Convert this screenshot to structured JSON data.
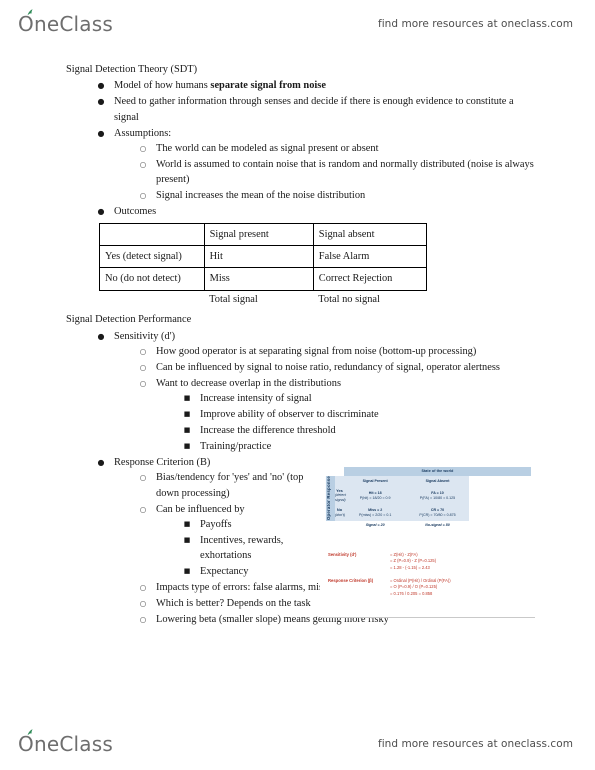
{
  "branding": {
    "logo_text": "OneClass",
    "tagline": "find more resources at oneclass.com",
    "leaf_color": "#2e8b57",
    "logo_color": "#6e6e6e"
  },
  "note": {
    "title_1": "Signal Detection Theory (SDT)",
    "title_2": "Signal Detection Performance",
    "sdt_bullets": {
      "b1_pre": "Model of how humans ",
      "b1_bold": "separate signal from noise",
      "b2": "Need to gather information through senses and decide if there is enough evidence to constitute a signal",
      "b3": "Assumptions:",
      "b3_subs": [
        "The world can be modeled as signal present or absent",
        "World is assumed to contain noise that is random and normally distributed (noise is always present)",
        "Signal increases the mean of the noise distribution"
      ],
      "b4": "Outcomes"
    },
    "outcomes_table": {
      "header": [
        "",
        "Signal present",
        "Signal absent"
      ],
      "rows": [
        [
          "Yes (detect signal)",
          "Hit",
          "False Alarm"
        ],
        [
          "No (do not detect)",
          "Miss",
          "Correct Rejection"
        ]
      ],
      "totals": [
        "",
        "Total signal",
        "Total no signal"
      ]
    },
    "sensitivity": {
      "label": "Sensitivity (d')",
      "subs": [
        "How good operator is at separating signal from noise (bottom-up processing)",
        "Can be influenced by signal to noise ratio, redundancy of signal, operator alertness",
        "Want to decrease overlap in the distributions"
      ],
      "subsubs": [
        "Increase intensity of signal",
        "Improve ability of observer to discriminate",
        "Increase the difference threshold",
        "Training/practice"
      ]
    },
    "response_criterion": {
      "label": "Response Criterion (B)",
      "subs_a": [
        "Bias/tendency for 'yes' and 'no' (top down processing)",
        "Can be influenced by"
      ],
      "subsubs": [
        "Payoffs",
        "Incentives, rewards, exhortations",
        "Expectancy"
      ],
      "subs_b": [
        "Impacts type of errors: false alarms, misses",
        "Which is better? Depends on the task",
        "Lowering beta (smaller slope) means getting more risky"
      ]
    }
  },
  "slide": {
    "matrix": {
      "top_header": "State of the world",
      "col_headers": [
        "Signal Present",
        "Signal Absent"
      ],
      "row_axis_label": "Operator Response",
      "rows": [
        {
          "label_line1": "Yes",
          "label_line2": "(detect signal)",
          "signal_present_l1": "Hit = 18",
          "signal_present_l2": "P(hit) = 18/20 = 0.9",
          "signal_absent_l1": "FA = 10",
          "signal_absent_l2": "P(FA) = 10/80 = 0.125"
        },
        {
          "label_line1": "No",
          "label_line2": "(don't)",
          "signal_present_l1": "Miss = 2",
          "signal_present_l2": "P(miss) = 2/20 = 0.1",
          "signal_absent_l1": "CR = 70",
          "signal_absent_l2": "P(CR) = 70/80 = 0.875"
        }
      ],
      "totals": [
        "Signal = 20",
        "No-signal = 80"
      ]
    },
    "formulas": [
      {
        "label": "Sensitivity (d')",
        "lines": [
          "= Z(Hit) - Z(FA)",
          "= Z (P=0.9) - Z (P=0.125)",
          "= 1.28 - (-1.15) = 2.43"
        ]
      },
      {
        "label": "Response Criterion (β)",
        "lines": [
          "= Ordinal (P(Hit) / Ordinal (P(FA))",
          "= O (P=0.9) / O (P=0.125)",
          "= 0.176 / 0.205 = 0.858"
        ]
      }
    ]
  }
}
